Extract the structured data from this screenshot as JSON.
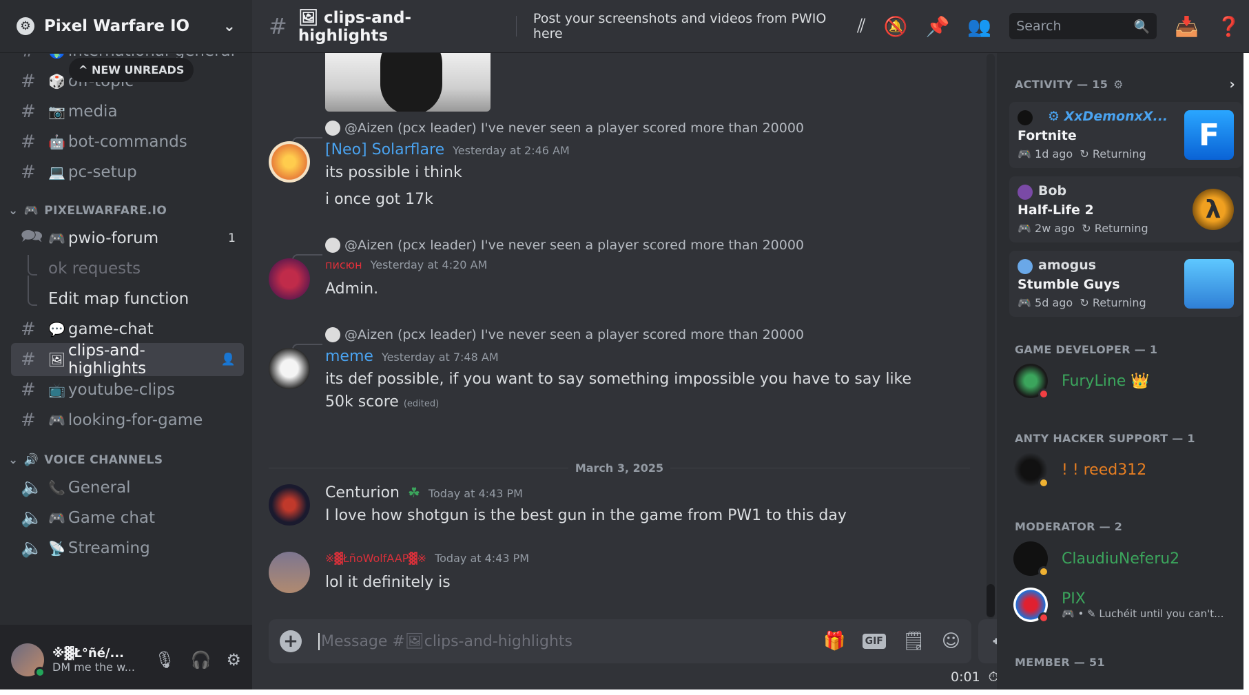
{
  "server": {
    "name": "Pixel Warfare IO",
    "icon": "gear-like-server-icon"
  },
  "new_unreads": "NEW UNREADS",
  "channels_top": [
    {
      "name": "international-general",
      "emoji": "🌍"
    },
    {
      "name": "off-topic",
      "emoji": "🎲"
    },
    {
      "name": "media",
      "emoji": "📷"
    },
    {
      "name": "bot-commands",
      "emoji": "🤖"
    },
    {
      "name": "pc-setup",
      "emoji": "💻"
    }
  ],
  "category_pixelwarfare": "PIXELWARFARE.IO",
  "forum": {
    "name": "pwio-forum",
    "emoji": "🎮",
    "badge": "1"
  },
  "threads": [
    "ok requests",
    "Edit map function"
  ],
  "channels_mid": [
    {
      "name": "game-chat",
      "emoji": "💬"
    },
    {
      "name": "clips-and-highlights",
      "emoji": "🖼"
    },
    {
      "name": "youtube-clips",
      "emoji": "📺"
    },
    {
      "name": "looking-for-game",
      "emoji": "🎮"
    }
  ],
  "category_voice": "VOICE CHANNELS",
  "voice": [
    {
      "name": "General",
      "emoji": "📞"
    },
    {
      "name": "Game chat",
      "emoji": "🎮"
    },
    {
      "name": "Streaming",
      "emoji": "📡"
    }
  ],
  "user": {
    "name": "※▓Ł°ñé/...",
    "status": "DM me the w..."
  },
  "channel": {
    "title": "clips-and-highlights",
    "topic": "Post your screenshots and videos from PWIO here"
  },
  "search": {
    "placeholder": "Search"
  },
  "messages": [
    {
      "reply_to": "@Aizen (pcx leader)",
      "reply_text": "I've never seen a player scored more than 20000",
      "author": "[Neo] Solarflare",
      "color": "#4aa3f0",
      "time": "Yesterday at 2:46 AM",
      "lines": [
        "its possible i think",
        "i once got 17k"
      ]
    },
    {
      "reply_to": "@Aizen (pcx leader)",
      "reply_text": "I've never seen a player scored more than 20000",
      "author": "писюн",
      "color": "#e0303a",
      "time": "Yesterday at 4:20 AM",
      "lines": [
        "Admin."
      ]
    },
    {
      "reply_to": "@Aizen (pcx leader)",
      "reply_text": "I've never seen a player scored more than 20000",
      "author": "meme",
      "color": "#4aa3f0",
      "time": "Yesterday at 7:48 AM",
      "lines": [
        "its def possible, if you want to say something impossible you have to say like",
        "50k score"
      ],
      "edited": "(edited)"
    },
    {
      "author": "Centurion",
      "color": "#dbdee1",
      "time": "Today at 4:43 PM",
      "lines": [
        "I love how shotgun is the best gun in the game from PW1 to this day"
      ]
    },
    {
      "author": "※▓ŁñoWolfAAP▓※",
      "color": "#d9303a",
      "time": "Today at 4:43 PM",
      "lines": [
        "lol it definitely is"
      ]
    }
  ],
  "date_divider": "March 3, 2025",
  "composer": {
    "placeholder": "Message #🖼clips-and-highlights",
    "gif": "GIF"
  },
  "timer": "0:01",
  "activity": {
    "header": "ACTIVITY — 15",
    "cards": [
      {
        "user": "XxDemonxX...",
        "game": "Fortnite",
        "ago": "1d ago",
        "tag": "Returning",
        "user_color": "#4aa3f0"
      },
      {
        "user": "Bob",
        "game": "Half-Life 2",
        "ago": "2w ago",
        "tag": "Returning",
        "user_color": "#dbdee1"
      },
      {
        "user": "amogus",
        "game": "Stumble Guys",
        "ago": "5d ago",
        "tag": "Returning",
        "user_color": "#dbdee1"
      }
    ]
  },
  "roles": [
    {
      "title": "GAME DEVELOPER — 1",
      "members": [
        {
          "name": "FuryLine",
          "color": "#3ba55c",
          "crown": "👑"
        }
      ]
    },
    {
      "title": "ANTY HACKER SUPPORT — 1",
      "members": [
        {
          "name": "! ! reed312",
          "color": "#e67e22"
        }
      ]
    },
    {
      "title": "MODERATOR — 2",
      "members": [
        {
          "name": "ClaudiuNeferu2",
          "color": "#3ba55c"
        },
        {
          "name": "PIX",
          "color": "#3ba55c",
          "sub": "Luchéit until you can't..."
        }
      ]
    },
    {
      "title": "MEMBER — 51"
    }
  ]
}
